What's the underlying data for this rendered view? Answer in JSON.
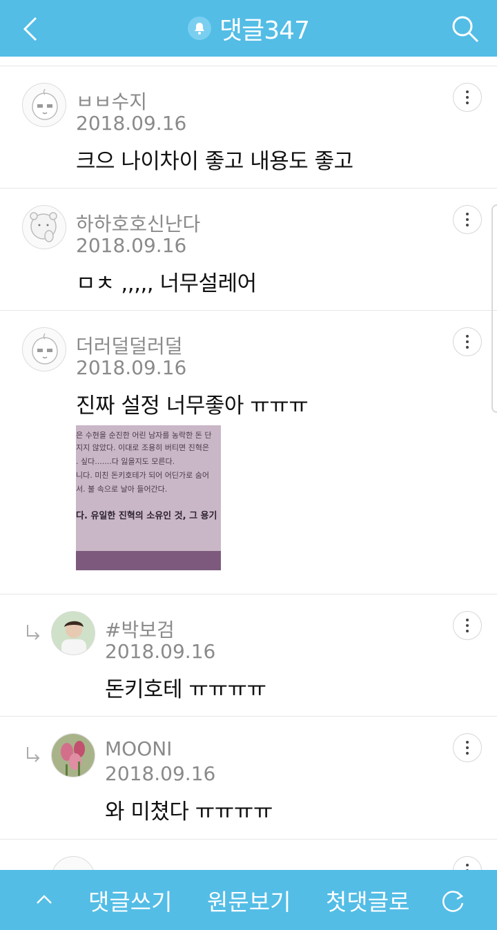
{
  "header": {
    "title": "댓글347",
    "back_icon": "chevron-left-icon",
    "bell_icon": "bell-icon",
    "search_icon": "search-icon"
  },
  "comments": [
    {
      "author": "ㅂㅂ수지",
      "date": "2018.09.16",
      "text": "크으 나이차이 좋고 내용도 좋고",
      "reply": false
    },
    {
      "author": "하하호호신난다",
      "date": "2018.09.16",
      "text": "ㅁㅊ ,,,,, 너무설레어",
      "reply": false
    },
    {
      "author": "더러덜덜러덜",
      "date": "2018.09.16",
      "text": "진짜 설정 너무좋아 ㅠㅠㅠ",
      "reply": false,
      "image_lines": [
        "은 수현을 순진한 어린 남자를 농락한 돈 단",
        "지지 않았다.  이대로 조용히 버티면 진혁은",
        ". 싶다.......다 잃을지도 모른다.",
        "니다.  미친 돈키호테가 되어 어딘가로 숨어",
        "서. 불 속으로 날아 들어간다.",
        "다. 유일한 진혁의 소유인 것, 그 용기"
      ]
    },
    {
      "author": "#박보검",
      "date": "2018.09.16",
      "text": "돈키호테 ㅠㅠㅠㅠ",
      "reply": true
    },
    {
      "author": "MOONI",
      "date": "2018.09.16",
      "text": "와 미쳤다 ㅠㅠㅠㅠ",
      "reply": true
    }
  ],
  "footer": {
    "write": "댓글쓰기",
    "view_original": "원문보기",
    "first_comment": "첫댓글로",
    "up_icon": "chevron-up-icon",
    "refresh_icon": "refresh-icon"
  },
  "colors": {
    "accent": "#53bde6",
    "meta_text": "#8a8a8a",
    "body_text": "#111111"
  }
}
